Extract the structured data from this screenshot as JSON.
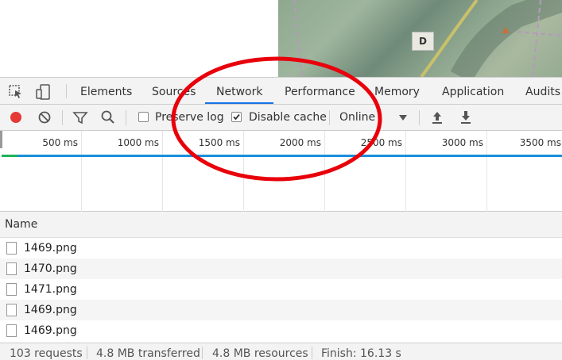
{
  "map": {
    "marker_label": "D"
  },
  "tabs": [
    {
      "label": "Elements",
      "active": false
    },
    {
      "label": "Sources",
      "active": false
    },
    {
      "label": "Network",
      "active": true
    },
    {
      "label": "Performance",
      "active": false
    },
    {
      "label": "Memory",
      "active": false
    },
    {
      "label": "Application",
      "active": false
    },
    {
      "label": "Audits",
      "active": false
    }
  ],
  "toolbar": {
    "preserve_log_label": "Preserve log",
    "preserve_log_checked": false,
    "disable_cache_label": "Disable cache",
    "disable_cache_checked": true,
    "throttle_value": "Online"
  },
  "timeline": {
    "ticks": [
      "500 ms",
      "1000 ms",
      "1500 ms",
      "2000 ms",
      "2500 ms",
      "3000 ms",
      "3500 ms"
    ]
  },
  "table": {
    "header": "Name",
    "rows": [
      "1469.png",
      "1470.png",
      "1471.png",
      "1469.png",
      "1469.png"
    ]
  },
  "status": {
    "requests": "103 requests",
    "transferred": "4.8 MB transferred",
    "resources": "4.8 MB resources",
    "finish": "Finish: 16.13 s"
  },
  "colors": {
    "record_red": "#e53935",
    "active_tab_underline": "#1a73e8",
    "annotation_red": "#e8000b"
  }
}
